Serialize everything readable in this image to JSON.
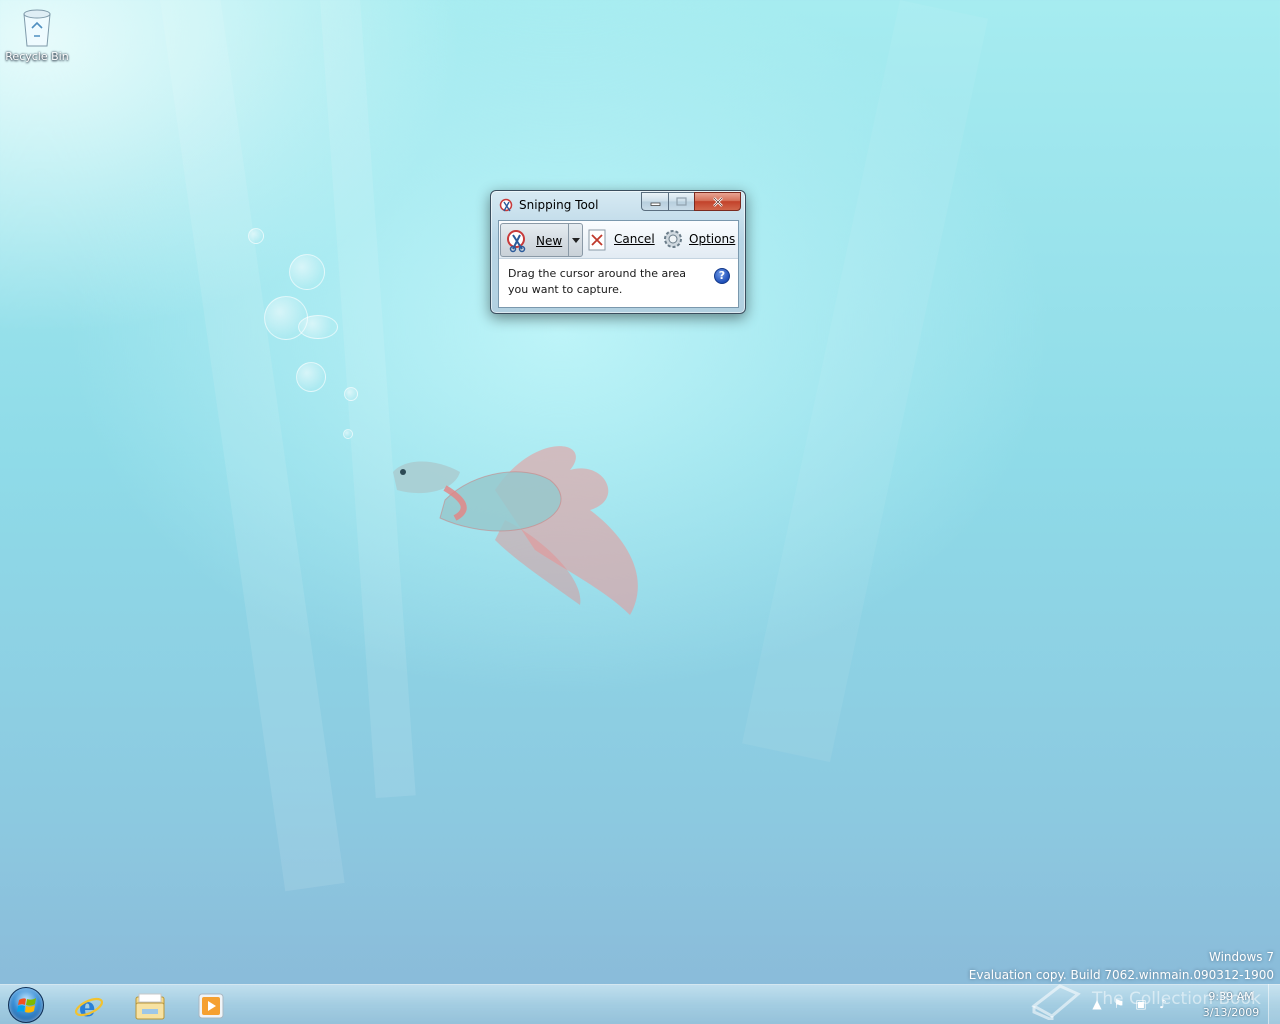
{
  "desktop": {
    "recycle_bin_label": "Recycle Bin"
  },
  "window": {
    "title": "Snipping Tool",
    "toolbar": {
      "new_label": "New",
      "cancel_label": "Cancel",
      "options_label": "Options"
    },
    "message_line1": "Drag the cursor around the area",
    "message_line2": "you want to capture.",
    "help_glyph": "?"
  },
  "watermark": {
    "line1": "Windows 7",
    "line2": "Evaluation copy. Build 7062.winmain.090312-1900"
  },
  "taskbar": {
    "apps": [
      "internet-explorer-icon",
      "windows-explorer-icon",
      "media-player-icon"
    ],
    "clock_time": "9:39 AM",
    "clock_date": "3/13/2009"
  },
  "credit": {
    "text": "The Collection Book"
  },
  "colors": {
    "desktop_base": "#9fe3ec",
    "close_button": "#c2422a",
    "help_blue": "#1f4fb8"
  }
}
